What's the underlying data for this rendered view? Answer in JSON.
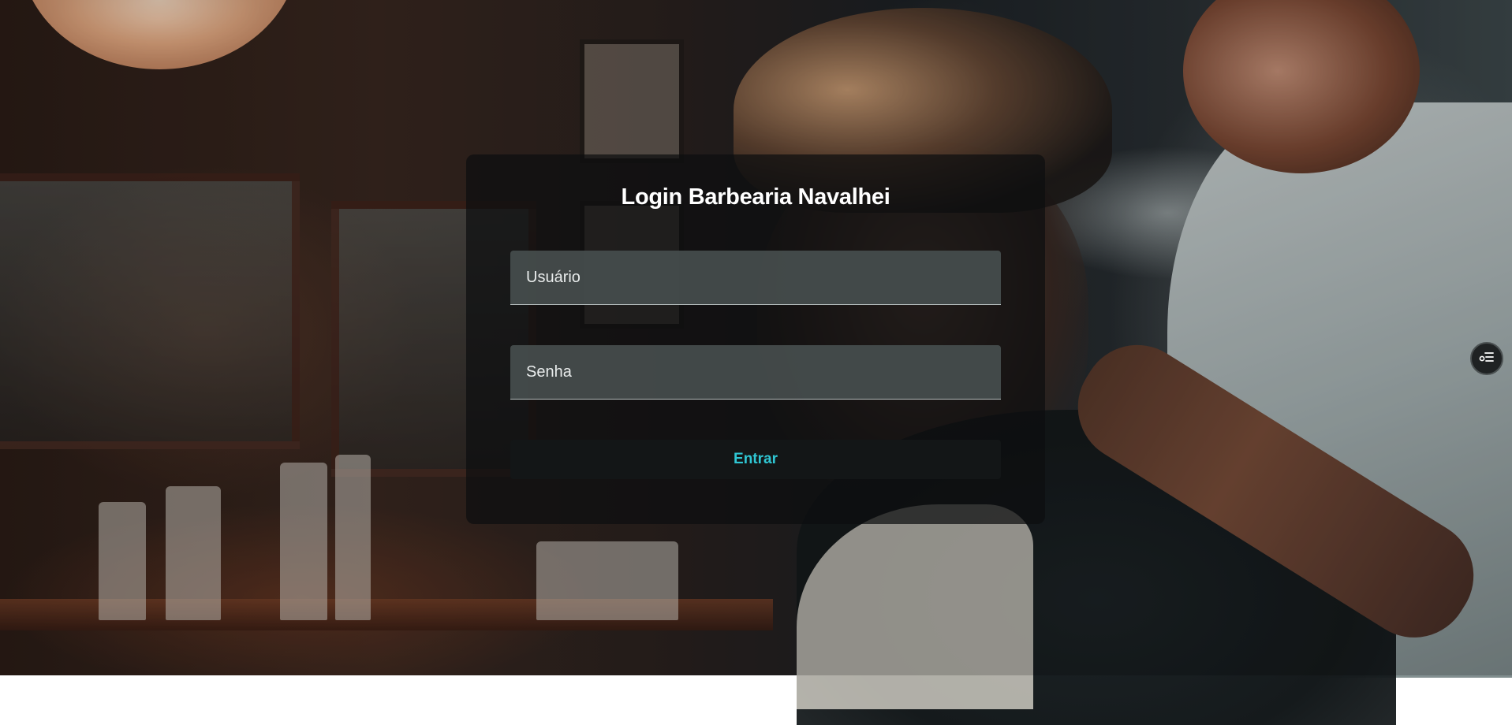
{
  "login": {
    "title": "Login Barbearia Navalhei",
    "username_placeholder": "Usuário",
    "password_placeholder": "Senha",
    "submit_label": "Entrar"
  },
  "floating_button": {
    "icon": "toggle-list-icon"
  },
  "colors": {
    "accent": "#2fc6d3",
    "card_background": "#0c0e0f",
    "field_background": "#444c4c",
    "button_background": "#131617"
  }
}
